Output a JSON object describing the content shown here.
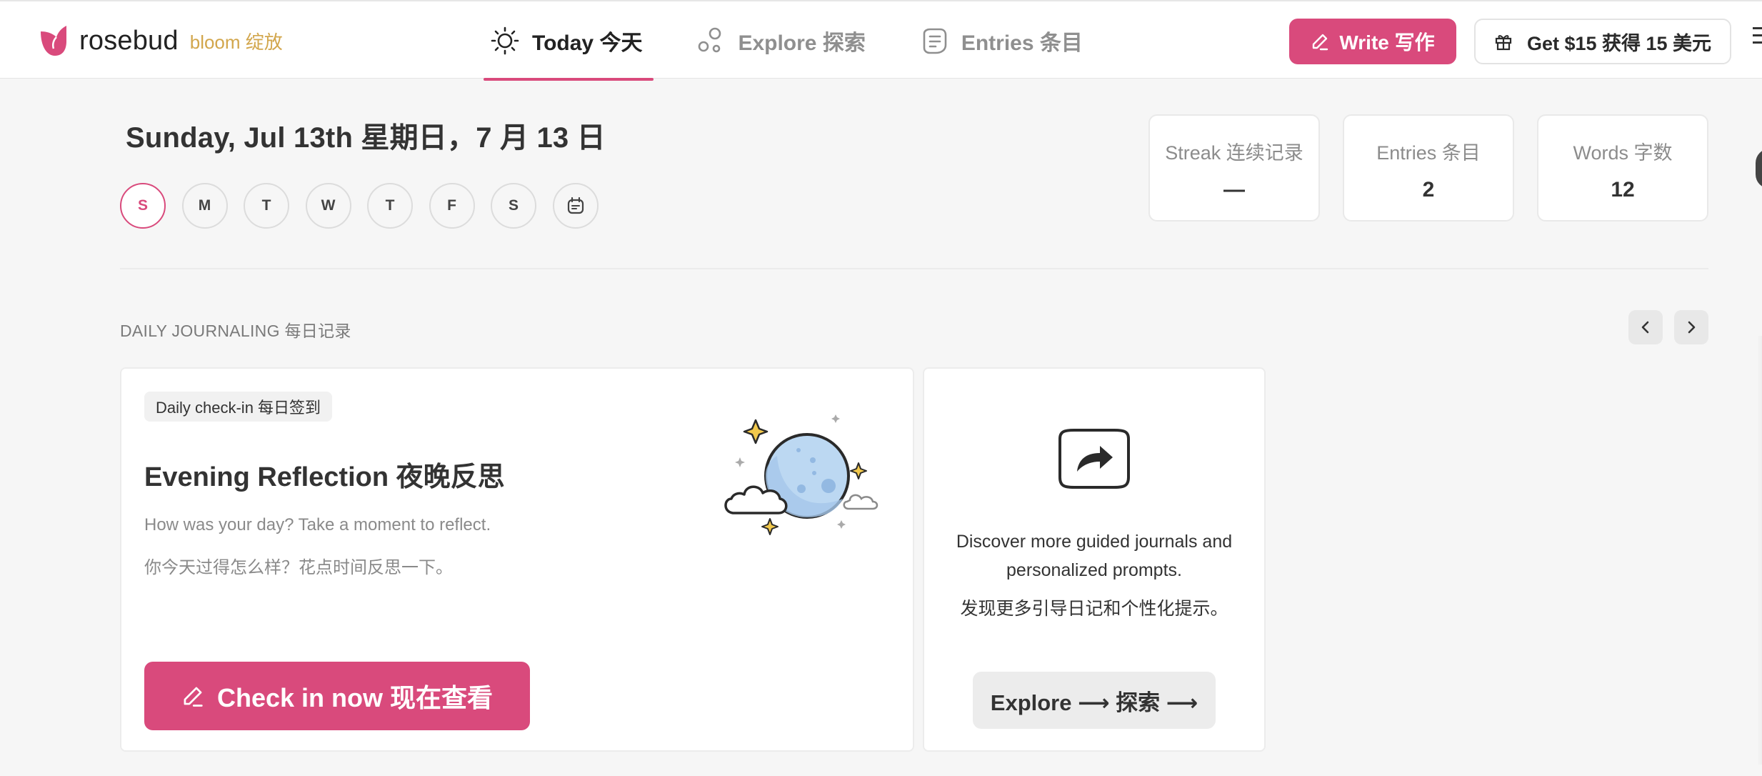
{
  "app": {
    "brand": "rosebud",
    "brand_tag": "bloom  绽放"
  },
  "nav": {
    "tabs": [
      {
        "label": "Today  今天",
        "icon": "sun-icon",
        "active": true
      },
      {
        "label": "Explore  探索",
        "icon": "bubbles-icon",
        "active": false
      },
      {
        "label": "Entries  条目",
        "icon": "entries-icon",
        "active": false
      }
    ]
  },
  "header_actions": {
    "write_label": "Write  写作",
    "get_label": "Get $15  获得 15 美元"
  },
  "date": {
    "title": "Sunday, Jul 13th  星期日，7 月 13 日",
    "week_days": [
      "S",
      "M",
      "T",
      "W",
      "T",
      "F",
      "S"
    ],
    "active_day_index": 0
  },
  "stats": [
    {
      "label": "Streak  连续记录",
      "value": "—"
    },
    {
      "label": "Entries  条目",
      "value": "2"
    },
    {
      "label": "Words  字数",
      "value": "12"
    }
  ],
  "section": {
    "label": "DAILY JOURNALING  每日记录"
  },
  "checkin_card": {
    "badge": "Daily check-in  每日签到",
    "title": "Evening Reflection  夜晚反思",
    "desc_en": "How was your day? Take a moment to reflect.",
    "desc_zh": "你今天过得怎么样？花点时间反思一下。",
    "button_label": "Check in now  现在查看"
  },
  "explore_card": {
    "text_en_line1": "Discover more guided journals and",
    "text_en_line2": "personalized prompts.",
    "text_zh": "发现更多引导日记和个性化提示。",
    "button_label": "Explore ⟶  探索 ⟶"
  },
  "colors": {
    "accent": "#d94a7c",
    "brand_tag": "#d2a64c",
    "background": "#f6f6f6"
  }
}
